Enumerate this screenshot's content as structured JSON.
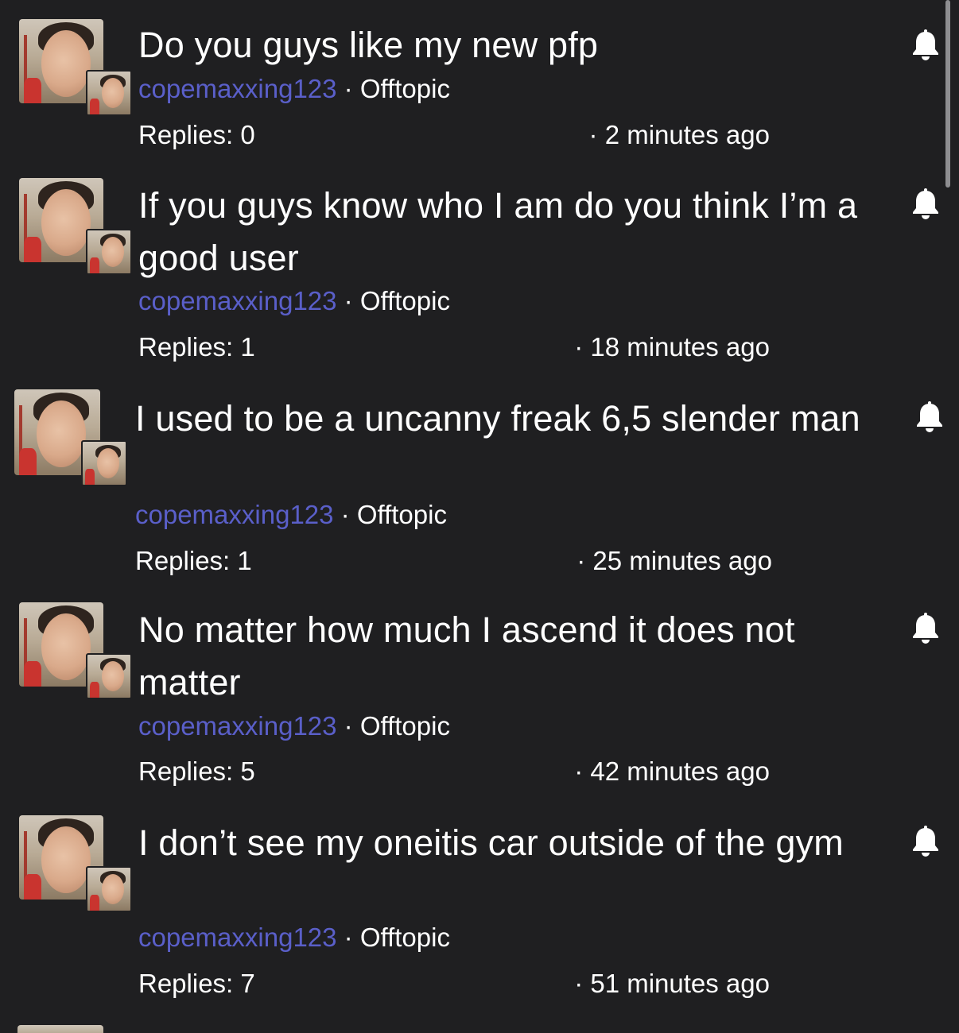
{
  "threads": [
    {
      "title": "Do you guys like my new pfp",
      "author": "copemaxxing123",
      "separator": "·",
      "category": "Offtopic",
      "replies": "Replies: 0",
      "time": "· 2 minutes ago",
      "bell_icon": "bell-icon"
    },
    {
      "title": "If you guys know who I am do you think I’m a good user",
      "author": "copemaxxing123",
      "separator": "·",
      "category": "Offtopic",
      "replies": "Replies: 1",
      "time": "· 18 minutes ago",
      "bell_icon": "bell-icon"
    },
    {
      "title": "I used to be a uncanny freak 6,5 slender man",
      "author": "copemaxxing123",
      "separator": "·",
      "category": "Offtopic",
      "replies": "Replies: 1",
      "time": "· 25 minutes ago",
      "bell_icon": "bell-icon"
    },
    {
      "title": "No matter how much I ascend it does not matter",
      "author": "copemaxxing123",
      "separator": "·",
      "category": "Offtopic",
      "replies": "Replies: 5",
      "time": "· 42 minutes ago",
      "bell_icon": "bell-icon"
    },
    {
      "title": "I don’t see my oneitis car outside of the gym",
      "author": "copemaxxing123",
      "separator": "·",
      "category": "Offtopic",
      "replies": "Replies: 7",
      "time": "· 51 minutes ago",
      "bell_icon": "bell-icon"
    }
  ],
  "colors": {
    "background": "#1f1f21",
    "author": "#5a5fc9",
    "text": "#ffffff"
  }
}
